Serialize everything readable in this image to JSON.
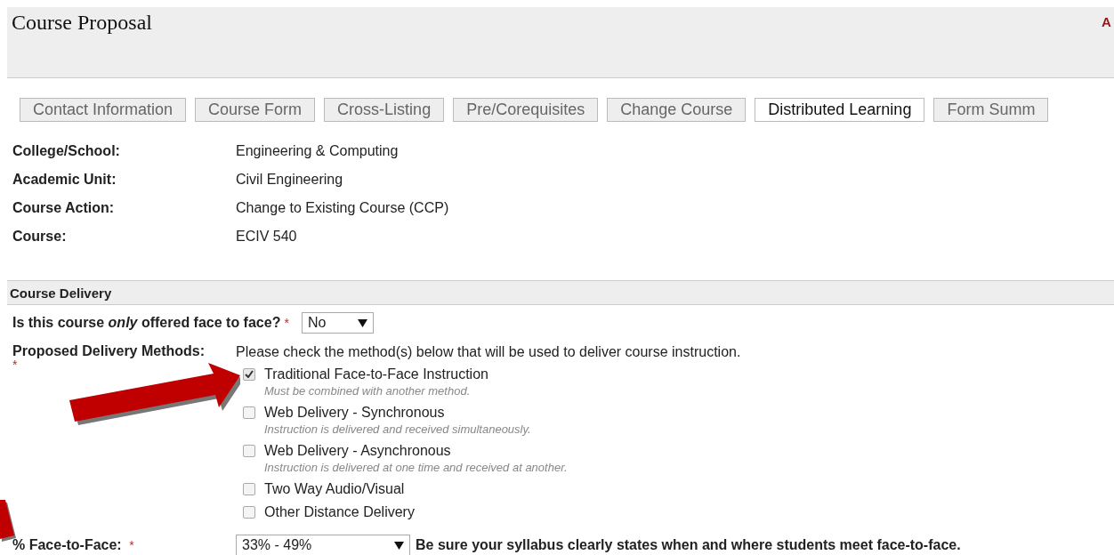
{
  "header": {
    "title": "Course Proposal",
    "corner_text": "A"
  },
  "tabs": [
    {
      "label": "Contact Information",
      "selected": false
    },
    {
      "label": "Course Form",
      "selected": false
    },
    {
      "label": "Cross-Listing",
      "selected": false
    },
    {
      "label": "Pre/Corequisites",
      "selected": false
    },
    {
      "label": "Change Course",
      "selected": false
    },
    {
      "label": "Distributed Learning",
      "selected": true
    },
    {
      "label": "Form Summ",
      "selected": false
    }
  ],
  "info": [
    {
      "label": "College/School:",
      "value": "Engineering & Computing"
    },
    {
      "label": "Academic Unit:",
      "value": "Civil Engineering"
    },
    {
      "label": "Course Action:",
      "value": "Change to Existing Course (CCP)"
    },
    {
      "label": "Course:",
      "value": "ECIV 540"
    }
  ],
  "section": {
    "title": "Course Delivery"
  },
  "face_question": {
    "label": "Is this course *only* offered face to face?",
    "required_mark": "*",
    "value": "No"
  },
  "delivery_methods": {
    "label": "Proposed Delivery Methods:",
    "required_mark": "*",
    "instruction": "Please check the method(s) below that will be used to deliver course instruction.",
    "options": [
      {
        "label": "Traditional Face-to-Face Instruction",
        "hint": "Must be combined with another method.",
        "checked": true
      },
      {
        "label": "Web Delivery - Synchronous",
        "hint": "Instruction is delivered and received simultaneously.",
        "checked": false
      },
      {
        "label": "Web Delivery - Asynchronous",
        "hint": "Instruction is delivered at one time and received at another.",
        "checked": false
      },
      {
        "label": "Two Way Audio/Visual",
        "checked": false
      },
      {
        "label": "Other Distance Delivery",
        "checked": false
      }
    ]
  },
  "percent_face": {
    "label": "% Face-to-Face:",
    "required_mark": "*",
    "value": "33% - 49%",
    "note": "Be sure your syllabus clearly states when and where students meet face-to-face."
  }
}
